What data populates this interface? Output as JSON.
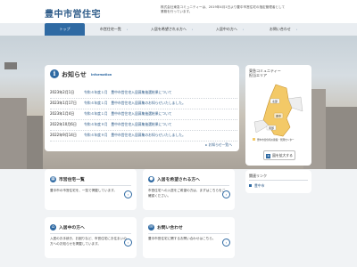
{
  "header": {
    "logo": "豊中市営住宅",
    "notice": "株式会社東急コミュニティーは、2019年4月1日より豊中市営住宅の指定管理者として業務を行っています。"
  },
  "nav": [
    {
      "label": "トップ",
      "active": true
    },
    {
      "label": "市営住宅一覧",
      "active": false
    },
    {
      "label": "入居を希望される方へ",
      "active": false
    },
    {
      "label": "入居中の方へ",
      "active": false
    },
    {
      "label": "お問い合わせ",
      "active": false
    }
  ],
  "news": {
    "icon": "info-icon",
    "title": "お知らせ",
    "subtitle": "Information",
    "items": [
      {
        "date": "2023年2月1日",
        "text": "令和４年度１月　豊中市営住宅入居募集抽選結果について"
      },
      {
        "date": "2023年1月17日",
        "text": "令和４年度１月　豊中市営住宅入居募集のお知らせいたしました。"
      },
      {
        "date": "2023年1月4日",
        "text": "令和４年度１月　豊中市営住宅入居募集抽選結果について"
      },
      {
        "date": "2022年10月6日",
        "text": "令和４年度９月　豊中市営住宅入居募集抽選結果について"
      },
      {
        "date": "2022年9月14日",
        "text": "令和４年度９月　豊中市営住宅入居募集のお知らせいたしました。"
      }
    ],
    "more": "お知らせ一覧へ"
  },
  "map_panel": {
    "title_line1": "東急コミュニティー",
    "title_line2": "担当エリア",
    "zoom_label": "図を拡大する",
    "legend": "豊中市営住宅の募集・管理センター",
    "labels": {
      "north": "北部",
      "center": "豊中",
      "south": "南部"
    }
  },
  "links_panel": {
    "title": "関連リンク",
    "link": "豊中市"
  },
  "bottom_cards": [
    {
      "icon": "building-icon",
      "title": "市営住宅一覧",
      "text": "豊中市の市営住宅を、一覧で掲載しています。"
    },
    {
      "icon": "person-icon",
      "title": "入居を希望される方へ",
      "text": "市営住宅への入居をご希望の方は、まずはこちらをご確認ください。"
    },
    {
      "icon": "house-icon",
      "title": "入居中の方へ",
      "text": "入居のお手続き、お困りなど、市営住宅にお住まいの方へのお知らせを掲載しています。"
    },
    {
      "icon": "mail-icon",
      "title": "お問い合わせ",
      "text": "豊中市営住宅に関するお問い合わせはこちら。"
    }
  ]
}
